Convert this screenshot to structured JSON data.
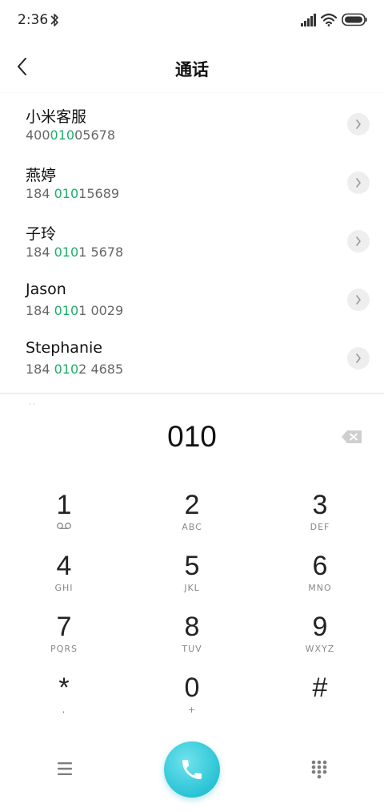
{
  "status_bar": {
    "time": "2:36"
  },
  "header": {
    "title": "通话"
  },
  "contacts": [
    {
      "name": "小米客服",
      "number_pre": "400",
      "number_match": "010",
      "number_post": "05678"
    },
    {
      "name": "燕婷",
      "number_pre": "184 ",
      "number_match": "010",
      "number_post": "15689"
    },
    {
      "name": "子玲",
      "number_pre": "184 ",
      "number_match": "010",
      "number_post": "1 5678"
    },
    {
      "name": "Jason",
      "number_pre": "184 ",
      "number_match": "010",
      "number_post": "1 0029"
    },
    {
      "name": "Stephanie",
      "number_pre": "184 ",
      "number_match": "010",
      "number_post": "2 4685"
    }
  ],
  "dialer": {
    "entered_number": "010"
  },
  "keypad": {
    "keys": [
      {
        "digit": "1",
        "letters": ""
      },
      {
        "digit": "2",
        "letters": "ABC"
      },
      {
        "digit": "3",
        "letters": "DEF"
      },
      {
        "digit": "4",
        "letters": "GHI"
      },
      {
        "digit": "5",
        "letters": "JKL"
      },
      {
        "digit": "6",
        "letters": "MNO"
      },
      {
        "digit": "7",
        "letters": "PQRS"
      },
      {
        "digit": "8",
        "letters": "TUV"
      },
      {
        "digit": "9",
        "letters": "WXYZ"
      },
      {
        "digit": "*",
        "letters": ","
      },
      {
        "digit": "0",
        "letters": "+"
      },
      {
        "digit": "#",
        "letters": ""
      }
    ]
  },
  "icons": {
    "back": "chevron-left-icon",
    "detail": "chevron-right-icon",
    "backspace": "backspace-icon",
    "voicemail": "voicemail-icon",
    "menu": "menu-icon",
    "call": "phone-icon",
    "dialpad": "dialpad-icon"
  },
  "colors": {
    "match_highlight": "#1fae6a",
    "call_button": "#2ac3d6"
  }
}
